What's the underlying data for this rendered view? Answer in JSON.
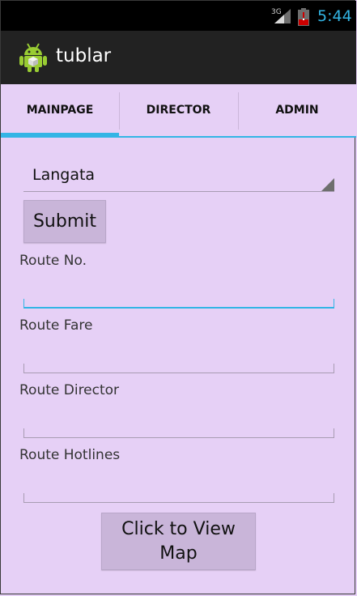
{
  "status_bar": {
    "network": "3G",
    "time": "5:44",
    "time_color": "#33b5e5"
  },
  "action_bar": {
    "title": "tublar",
    "icon": "android-robot-icon"
  },
  "tabs": [
    {
      "label": "MAINPAGE",
      "selected": true
    },
    {
      "label": "DIRECTOR",
      "selected": false
    },
    {
      "label": "ADMIN",
      "selected": false
    }
  ],
  "form": {
    "spinner_value": "Langata",
    "submit_label": "Submit",
    "fields": [
      {
        "label": "Route No.",
        "value": "",
        "focused": true
      },
      {
        "label": "Route Fare",
        "value": "",
        "focused": false
      },
      {
        "label": "Route Director",
        "value": "",
        "focused": false
      },
      {
        "label": "Route Hotlines",
        "value": "",
        "focused": false
      }
    ],
    "map_button_label": "Click to View Map"
  },
  "colors": {
    "accent": "#33b5e5",
    "background": "#e6d0f6",
    "button": "#c9b5d9"
  }
}
